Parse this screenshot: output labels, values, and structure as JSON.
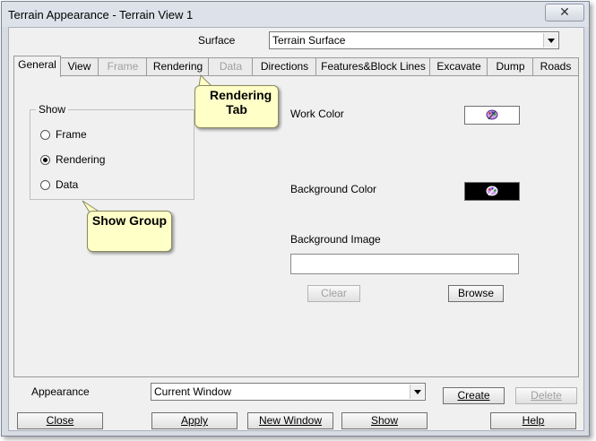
{
  "window": {
    "title": "Terrain Appearance - Terrain View 1",
    "close_glyph": "✕"
  },
  "surface": {
    "label": "Surface",
    "value": "Terrain Surface"
  },
  "tabs": [
    {
      "label": "General",
      "state": "active"
    },
    {
      "label": "View",
      "state": "enabled"
    },
    {
      "label": "Frame",
      "state": "disabled"
    },
    {
      "label": "Rendering",
      "state": "enabled"
    },
    {
      "label": "Data",
      "state": "disabled"
    },
    {
      "label": "Directions",
      "state": "enabled"
    },
    {
      "label": "Features&Block Lines",
      "state": "enabled"
    },
    {
      "label": "Excavate",
      "state": "enabled"
    },
    {
      "label": "Dump",
      "state": "enabled"
    },
    {
      "label": "Roads",
      "state": "enabled"
    }
  ],
  "show_group": {
    "title": "Show",
    "options": [
      {
        "label": "Frame",
        "selected": false
      },
      {
        "label": "Rendering",
        "selected": true
      },
      {
        "label": "Data",
        "selected": false
      }
    ]
  },
  "work_color": {
    "label": "Work Color",
    "swatch_color": "#ffffff",
    "icon": "palette-icon"
  },
  "background_color": {
    "label": "Background Color",
    "swatch_color": "#000000",
    "icon": "palette-icon"
  },
  "background_image": {
    "label": "Background Image",
    "value": "",
    "clear_label": "Clear",
    "browse_label": "Browse"
  },
  "appearance": {
    "label": "Appearance",
    "value": "Current Window",
    "create_label": "Create",
    "delete_label": "Delete"
  },
  "footer": {
    "close_label": "Close",
    "apply_label": "Apply",
    "new_window_label": "New Window",
    "show_label": "Show",
    "help_label": "Help"
  },
  "callouts": {
    "rendering_tab": "Rendering Tab",
    "show_group": "Show Group"
  },
  "colors": {
    "callout_bg": "#ffffc8",
    "dialog_bg": "#f0f0f0",
    "frame_bg": "#d6dbe4"
  }
}
